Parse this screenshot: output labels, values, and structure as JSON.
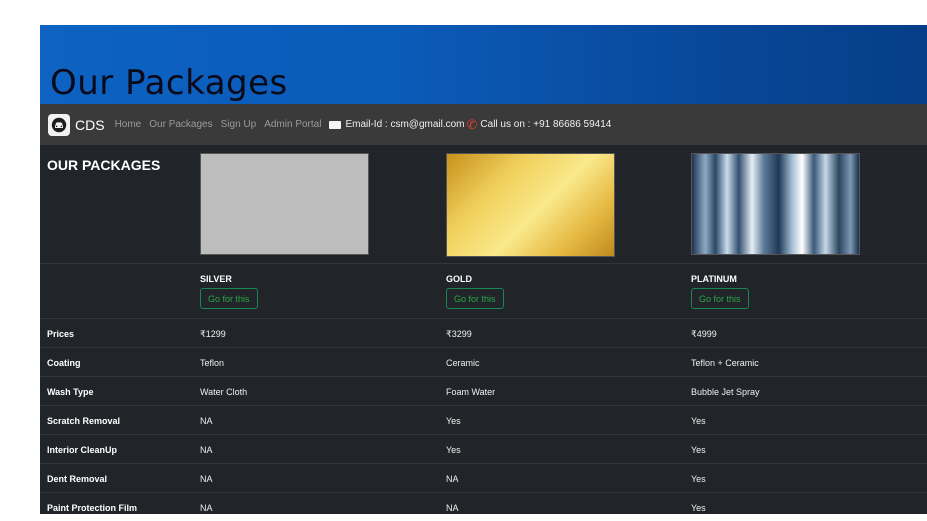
{
  "hero": {
    "title": "Our Packages"
  },
  "navbar": {
    "brand": "CDS",
    "links": [
      "Home",
      "Our Packages",
      "Sign Up",
      "Admin Portal"
    ],
    "email": "Email-Id : csm@gmail.com",
    "phone": "Call us on : +91 86686 59414"
  },
  "section_title": "OUR PACKAGES",
  "packages": [
    {
      "name": "SILVER",
      "button": "Go for this",
      "color": "#bdbdbd"
    },
    {
      "name": "GOLD",
      "button": "Go for this",
      "color": "#f0cf5b"
    },
    {
      "name": "PLATINUM",
      "button": "Go for this",
      "color": "#8fa9c4"
    }
  ],
  "rows": [
    {
      "label": "Prices",
      "values": [
        "₹1299",
        "₹3299",
        "₹4999"
      ]
    },
    {
      "label": "Coating",
      "values": [
        "Teflon",
        "Ceramic",
        "Teflon + Ceramic"
      ]
    },
    {
      "label": "Wash Type",
      "values": [
        "Water Cloth",
        "Foam Water",
        "Bubble Jet Spray"
      ]
    },
    {
      "label": "Scratch Removal",
      "values": [
        "NA",
        "Yes",
        "Yes"
      ]
    },
    {
      "label": "Interior CleanUp",
      "values": [
        "NA",
        "Yes",
        "Yes"
      ]
    },
    {
      "label": "Dent Removal",
      "values": [
        "NA",
        "NA",
        "Yes"
      ]
    },
    {
      "label": "Paint Protection Film",
      "values": [
        "NA",
        "NA",
        "Yes"
      ]
    }
  ]
}
